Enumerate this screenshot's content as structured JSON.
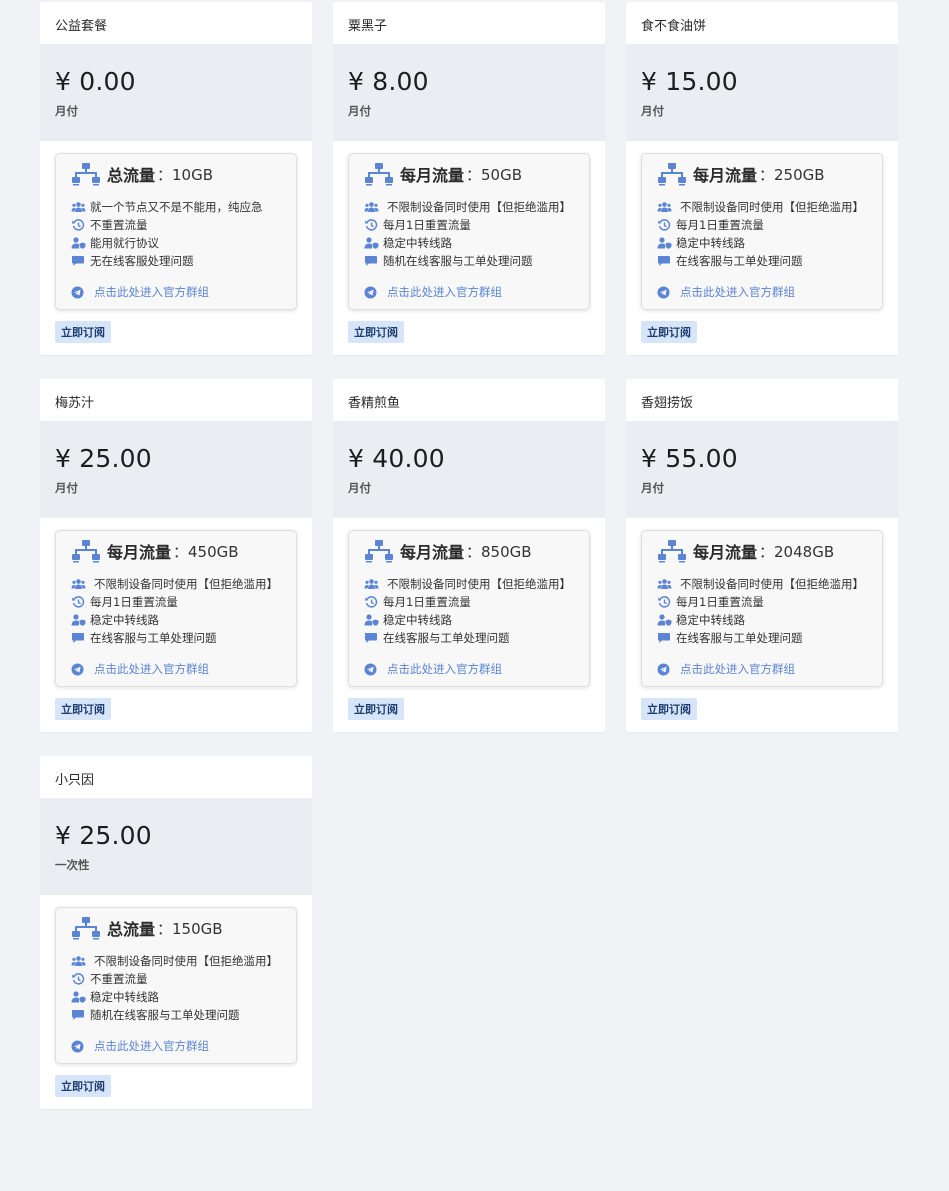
{
  "currency": "¥",
  "link_text": "点击此处进入官方群组",
  "subscribe_label": "立即订阅",
  "accent_color": "#5b84d4",
  "plans": [
    {
      "name": "公益套餐",
      "price": "¥ 0.00",
      "period": "月付",
      "traffic_label": "总流量",
      "traffic_value": "：10GB",
      "features": [
        {
          "icon": "users-icon",
          "text": "就一个节点又不是不能用，纯应急"
        },
        {
          "icon": "history-icon",
          "text": "不重置流量"
        },
        {
          "icon": "user-shield-icon",
          "text": "能用就行协议"
        },
        {
          "icon": "chat-icon",
          "text": "无在线客服处理问题"
        }
      ]
    },
    {
      "name": "粟黑子",
      "price": "¥ 8.00",
      "period": "月付",
      "traffic_label": "每月流量",
      "traffic_value": "：50GB",
      "features": [
        {
          "icon": "users-icon",
          "text": "不限制设备同时使用【但拒绝滥用】"
        },
        {
          "icon": "history-icon",
          "text": "每月1日重置流量"
        },
        {
          "icon": "user-shield-icon",
          "text": "稳定中转线路"
        },
        {
          "icon": "chat-icon",
          "text": "随机在线客服与工单处理问题"
        }
      ]
    },
    {
      "name": "食不食油饼",
      "price": "¥ 15.00",
      "period": "月付",
      "traffic_label": "每月流量",
      "traffic_value": "：250GB",
      "features": [
        {
          "icon": "users-icon",
          "text": "不限制设备同时使用【但拒绝滥用】"
        },
        {
          "icon": "history-icon",
          "text": "每月1日重置流量"
        },
        {
          "icon": "user-shield-icon",
          "text": "稳定中转线路"
        },
        {
          "icon": "chat-icon",
          "text": "在线客服与工单处理问题"
        }
      ]
    },
    {
      "name": "梅苏汁",
      "price": "¥ 25.00",
      "period": "月付",
      "traffic_label": "每月流量",
      "traffic_value": "：450GB",
      "features": [
        {
          "icon": "users-icon",
          "text": "不限制设备同时使用【但拒绝滥用】"
        },
        {
          "icon": "history-icon",
          "text": "每月1日重置流量"
        },
        {
          "icon": "user-shield-icon",
          "text": "稳定中转线路"
        },
        {
          "icon": "chat-icon",
          "text": "在线客服与工单处理问题"
        }
      ]
    },
    {
      "name": "香精煎鱼",
      "price": "¥ 40.00",
      "period": "月付",
      "traffic_label": "每月流量",
      "traffic_value": "：850GB",
      "features": [
        {
          "icon": "users-icon",
          "text": "不限制设备同时使用【但拒绝滥用】"
        },
        {
          "icon": "history-icon",
          "text": "每月1日重置流量"
        },
        {
          "icon": "user-shield-icon",
          "text": "稳定中转线路"
        },
        {
          "icon": "chat-icon",
          "text": "在线客服与工单处理问题"
        }
      ]
    },
    {
      "name": "香翅捞饭",
      "price": "¥ 55.00",
      "period": "月付",
      "traffic_label": "每月流量",
      "traffic_value": "：2048GB",
      "features": [
        {
          "icon": "users-icon",
          "text": "不限制设备同时使用【但拒绝滥用】"
        },
        {
          "icon": "history-icon",
          "text": "每月1日重置流量"
        },
        {
          "icon": "user-shield-icon",
          "text": "稳定中转线路"
        },
        {
          "icon": "chat-icon",
          "text": "在线客服与工单处理问题"
        }
      ]
    },
    {
      "name": "小只因",
      "price": "¥ 25.00",
      "period": "一次性",
      "traffic_label": "总流量",
      "traffic_value": "：150GB",
      "features": [
        {
          "icon": "users-icon",
          "text": "不限制设备同时使用【但拒绝滥用】"
        },
        {
          "icon": "history-icon",
          "text": "不重置流量"
        },
        {
          "icon": "user-shield-icon",
          "text": "稳定中转线路"
        },
        {
          "icon": "chat-icon",
          "text": "随机在线客服与工单处理问题"
        }
      ]
    }
  ]
}
